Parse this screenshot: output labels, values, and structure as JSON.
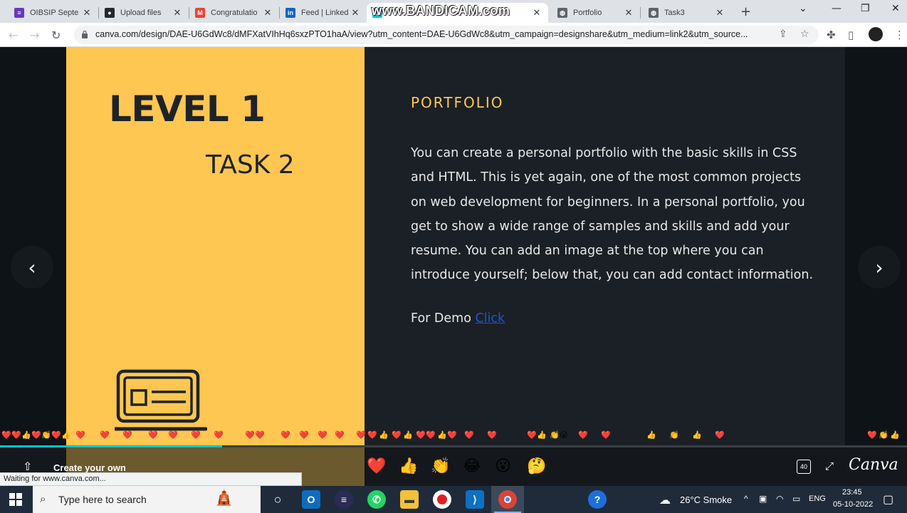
{
  "browser": {
    "tabs": [
      {
        "title": "OIBSIP Septe",
        "icon": "forms-icon",
        "color": "#673ab7"
      },
      {
        "title": "Upload files",
        "icon": "github-icon",
        "color": "#24292e"
      },
      {
        "title": "Congratulatio",
        "icon": "gmail-icon",
        "color": "#ea4335"
      },
      {
        "title": "Feed | Linked",
        "icon": "linkedin-icon",
        "color": "#0a66c2"
      },
      {
        "title": "",
        "icon": "canva-icon",
        "color": "#00c4cc"
      },
      {
        "title": "Portfolio",
        "icon": "globe-icon",
        "color": "#5f6368"
      },
      {
        "title": "Task3",
        "icon": "globe-icon",
        "color": "#5f6368"
      }
    ],
    "watermark": "www.BANDICAM.com",
    "url": "canva.com/design/DAE-U6GdWc8/dMFXatVIhHq6sxzPTO1haA/view?utm_content=DAE-U6GdWc8&utm_campaign=designshare&utm_medium=link2&utm_source..."
  },
  "slide": {
    "level": "LEVEL 1",
    "task": "TASK 2",
    "heading": "PORTFOLIO",
    "body": "You can create a personal portfolio with the basic skills in CSS and HTML. This is yet again, one of the most common projects on web development for beginners. In a personal portfolio, you get to show a wide range of samples and skills and add your resume. You can add an image at the top where you can introduce yourself; below that, you can add contact information.",
    "demo_label": "For Demo",
    "demo_link": "Click",
    "colors": {
      "yellow": "#fec752",
      "dark": "#1b2026"
    }
  },
  "viewer": {
    "create_own": "Create your own",
    "page_count": "40",
    "brand": "Canva",
    "progress": 0.245,
    "reactions": [
      "❤️",
      "👍",
      "👏",
      "😂",
      "😮",
      "🤔"
    ]
  },
  "status_text": "Waiting for www.canva.com...",
  "taskbar": {
    "search_placeholder": "Type here to search",
    "weather": "26°C  Smoke",
    "language": "ENG",
    "time": "23:45",
    "date": "05-10-2022"
  }
}
